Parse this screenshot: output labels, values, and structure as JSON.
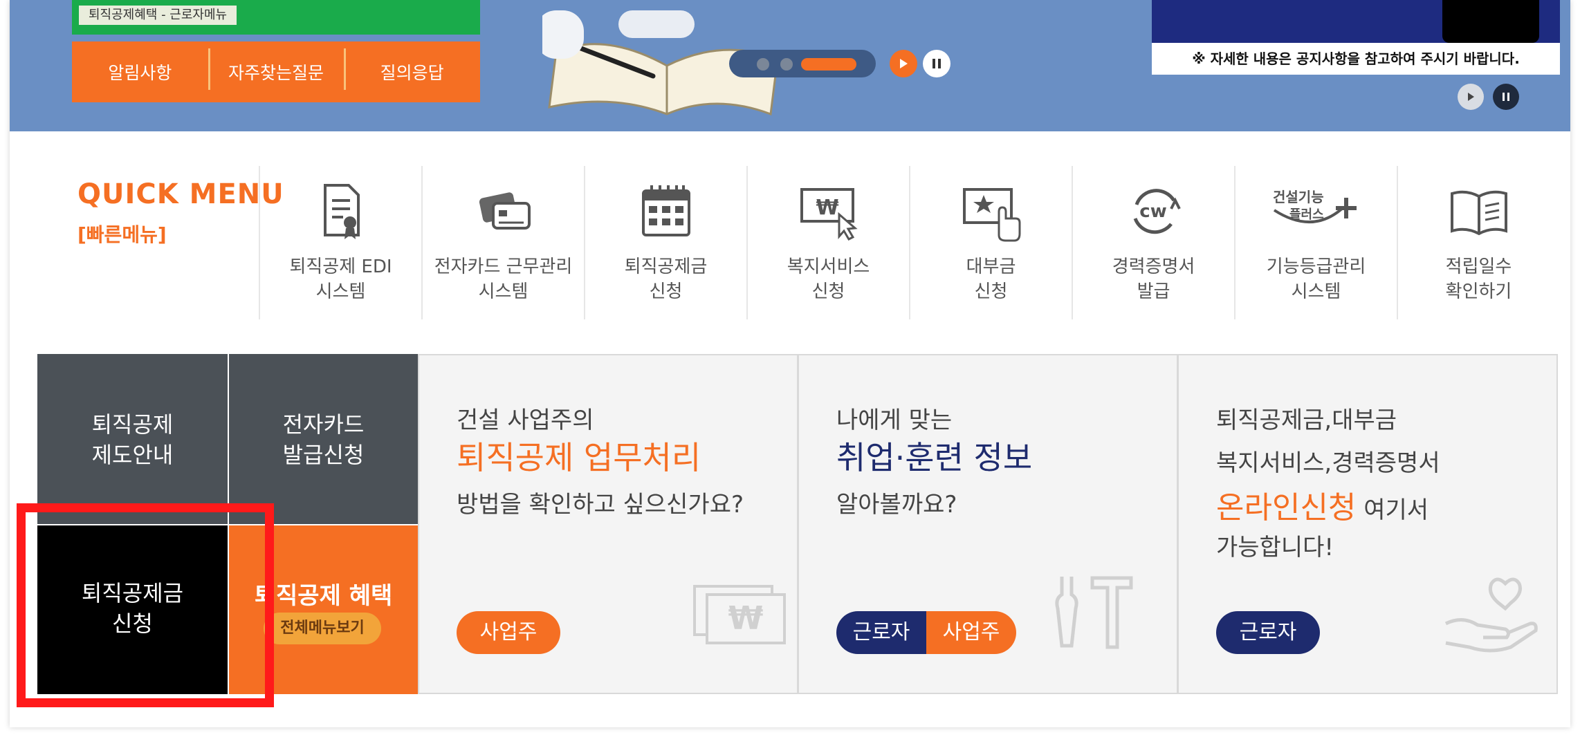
{
  "banner": {
    "tag": "퇴직공제혜택 - 근로자메뉴",
    "menu": [
      "알림사항",
      "자주찾는질문",
      "질의응답"
    ],
    "notice_text": "※ 자세한 내용은 공지사항을 참고하여 주시기 바랍니다."
  },
  "quick_menu": {
    "title": "QUICK MENU",
    "subtitle": "[빠른메뉴]",
    "items": [
      {
        "line1": "퇴직공제 EDI",
        "line2": "시스템",
        "icon": "document-certificate-icon"
      },
      {
        "line1": "전자카드 근무관리",
        "line2": "시스템",
        "icon": "cards-icon"
      },
      {
        "line1": "퇴직공제금",
        "line2": "신청",
        "icon": "calendar-icon"
      },
      {
        "line1": "복지서비스",
        "line2": "신청",
        "icon": "won-screen-click-icon"
      },
      {
        "line1": "대부금",
        "line2": "신청",
        "icon": "monitor-star-click-icon"
      },
      {
        "line1": "경력증명서",
        "line2": "발급",
        "icon": "cw-logo-icon"
      },
      {
        "line1": "기능등급관리",
        "line2": "시스템",
        "icon": "construction-skill-plus-icon"
      },
      {
        "line1": "적립일수",
        "line2": "확인하기",
        "icon": "open-book-icon"
      }
    ],
    "skill_plus_text": [
      "건설기능",
      "플러스"
    ],
    "cw_text": "cw"
  },
  "tiles": {
    "t1": [
      "퇴직공제",
      "제도안내"
    ],
    "t2": [
      "전자카드",
      "발급신청"
    ],
    "t3": [
      "퇴직공제금",
      "신청"
    ],
    "t4_title": "퇴직공제 혜택",
    "t4_button": "전체메뉴보기"
  },
  "panels": {
    "p1": {
      "line1": "건설 사업주의",
      "big": "퇴직공제 업무처리",
      "line3": "방법을 확인하고 싶으신가요?",
      "button": "사업주"
    },
    "p2": {
      "line1": "나에게 맞는",
      "big": "취업·훈련 정보",
      "line3": "알아볼까요?",
      "button_a": "근로자",
      "button_b": "사업주"
    },
    "p3": {
      "line1": "퇴직공제금,대부금",
      "line2": "복지서비스,경력증명서",
      "big": "온라인신청",
      "big_suffix": " 여기서",
      "line4": "가능합니다!",
      "button": "근로자"
    }
  },
  "colors": {
    "accent": "#f56f23",
    "navy": "#1e2b6e",
    "dark": "#4b5157",
    "highlight": "#ff1a1a"
  }
}
